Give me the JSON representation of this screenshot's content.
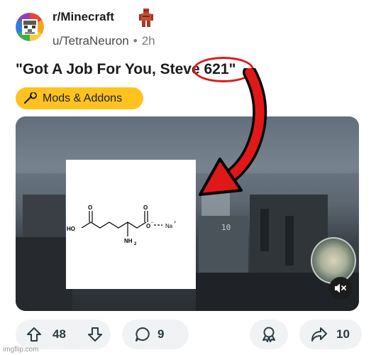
{
  "header": {
    "subreddit": "r/Minecraft",
    "author": "u/TetraNeuron",
    "separator": "•",
    "age": "2h"
  },
  "post": {
    "title": "\"Got A Job For You, Steve 621\"",
    "flair": "Mods & Addons",
    "flair_color": "#ffc21f",
    "highlight_color": "#e01818"
  },
  "molecule": {
    "ho_label": "HO",
    "nh2_label": "NH",
    "nh2_sub": "2",
    "o_top_left": "O",
    "o_top_right": "O",
    "o_minus": "O",
    "na_label": "Na",
    "plus": "+",
    "minus": "−"
  },
  "media": {
    "mute_icon": "speaker-muted-icon",
    "hud_number": "10"
  },
  "actions": {
    "upvote_icon": "arrow-up-icon",
    "score": "48",
    "downvote_icon": "arrow-down-icon",
    "comment_icon": "comment-bubble-icon",
    "comments": "9",
    "award_icon": "award-icon",
    "share_icon": "share-arrow-icon",
    "shares": "10"
  },
  "watermark": "imgflip.com"
}
